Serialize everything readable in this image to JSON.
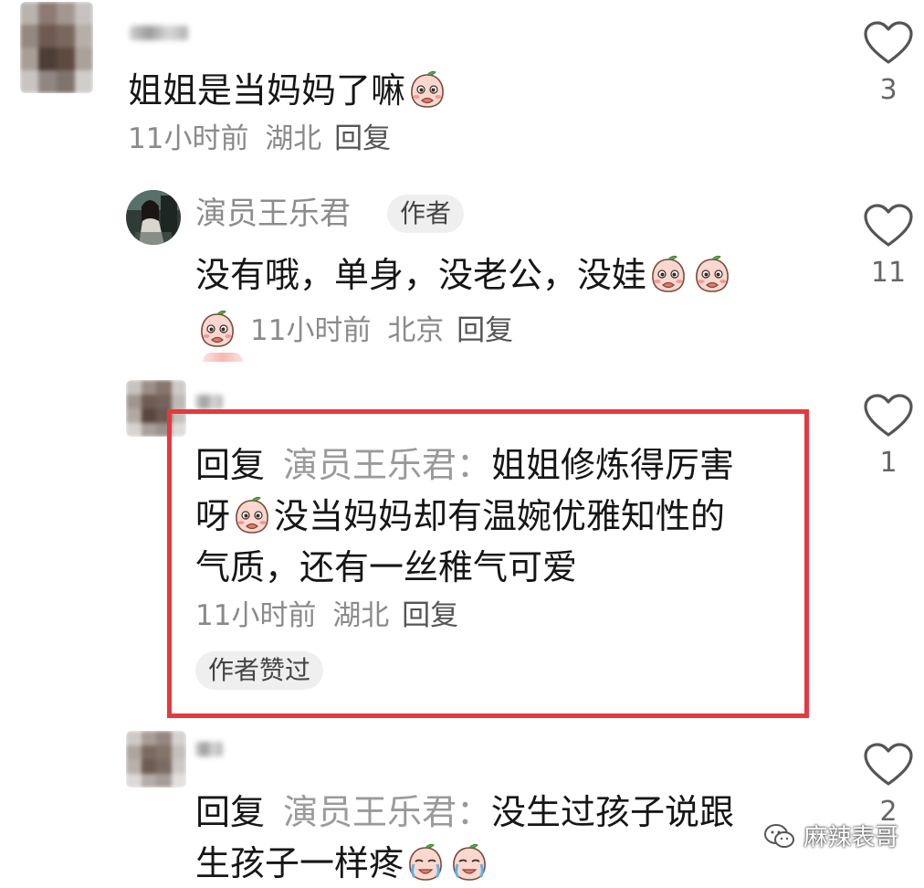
{
  "comments": [
    {
      "text": "姐姐是当妈妈了嘛",
      "time": "11小时前",
      "location": "湖北",
      "reply_label": "回复",
      "likes": "3"
    },
    {
      "author": "演员王乐君",
      "author_tag": "作者",
      "text": "没有哦，单身，没老公，没娃",
      "time": "11小时前",
      "location": "北京",
      "reply_label": "回复",
      "likes": "11"
    },
    {
      "reply_prefix": "回复",
      "reply_to": "演员王乐君：",
      "text_line1": "姐姐修炼得厉害",
      "text_line2_a": "呀",
      "text_line2_b": "没当妈妈却有温婉优雅知性的",
      "text_line3": "气质，还有一丝稚气可爱",
      "time": "11小时前",
      "location": "湖北",
      "reply_label": "回复",
      "liked_badge": "作者赞过",
      "likes": "1"
    },
    {
      "reply_prefix": "回复",
      "reply_to": "演员王乐君：",
      "text_line1": "没生过孩子说跟",
      "text_line2": "生孩子一样疼",
      "likes": "2"
    }
  ],
  "watermark": "麻辣表哥",
  "icons": {
    "like": "heart-outline-icon",
    "emoji_shy": "peach-shy-emoji",
    "emoji_cry": "peach-crying-emoji",
    "watermark_logo": "wechat-icon"
  },
  "colors": {
    "highlight_border": "#e5393d",
    "meta_text": "#8a8a8a",
    "tag_bg": "#efefef"
  }
}
